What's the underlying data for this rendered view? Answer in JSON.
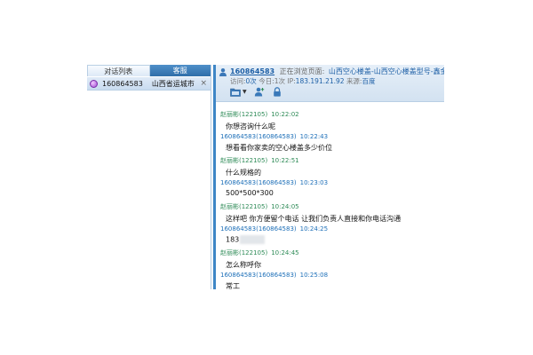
{
  "left": {
    "tabs": [
      {
        "label": "对话列表",
        "active": true
      },
      {
        "label": "客服",
        "active": false
      }
    ],
    "visitor": {
      "id": "160864583",
      "city": "山西省运城市",
      "close": "×"
    }
  },
  "header": {
    "visitor_id": "160864583",
    "browsing_label": "正在浏览页面:",
    "page_title": "山西空心楼盖-山西空心楼盖型号-鑫金利建材",
    "visits_label": "访问:",
    "visits_value": "0次",
    "today_label": "今日:",
    "today_value": "1次",
    "ip_label": "IP:",
    "ip_value": "183.191.21.92",
    "source_label": "来源:",
    "source_value": "百度"
  },
  "messages": [
    {
      "sender": "赵丽彬(122105)",
      "time": "10:22:02",
      "text": "你想咨询什么呢",
      "role": "agent"
    },
    {
      "sender": "160864583(160864583)",
      "time": "10:22:43",
      "text": "想看看你家卖的空心楼盖多少价位",
      "role": "visitor"
    },
    {
      "sender": "赵丽彬(122105)",
      "time": "10:22:51",
      "text": "什么规格的",
      "role": "agent"
    },
    {
      "sender": "160864583(160864583)",
      "time": "10:23:03",
      "text": "500*500*300",
      "role": "visitor"
    },
    {
      "sender": "赵丽彬(122105)",
      "time": "10:24:05",
      "text": "这样吧 你方便留个电话   让我们负责人直接和你电话沟通",
      "role": "agent"
    },
    {
      "sender": "160864583(160864583)",
      "time": "10:24:25",
      "text": "183",
      "role": "visitor"
    },
    {
      "sender": "赵丽彬(122105)",
      "time": "10:24:45",
      "text": "怎么称呼你",
      "role": "agent"
    },
    {
      "sender": "160864583(160864583)",
      "time": "10:25:08",
      "text": "常工",
      "role": "visitor"
    }
  ],
  "colors": {
    "accent": "#3e86c6",
    "link": "#1d5fa6",
    "agent": "#2e8b57",
    "visitor": "#1d6fb8"
  },
  "icons": [
    "folder-icon",
    "add-user-icon",
    "lock-icon",
    "user-icon"
  ]
}
